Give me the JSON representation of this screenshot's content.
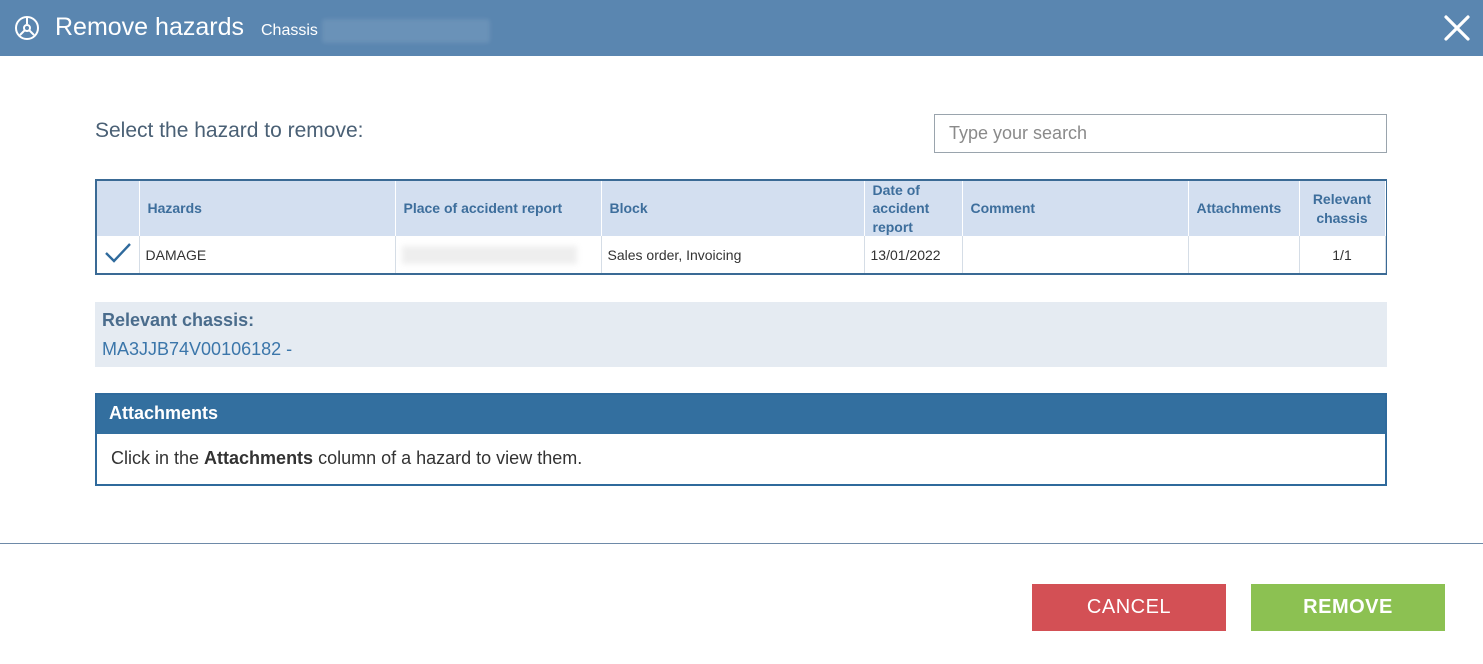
{
  "dialog": {
    "title": "Remove hazards",
    "subtitle": "Chassis"
  },
  "prompt": "Select the hazard to remove:",
  "search": {
    "placeholder": "Type your search",
    "value": ""
  },
  "table": {
    "columns": [
      "Hazards",
      "Place of accident report",
      "Block",
      "Date of accident report",
      "Comment",
      "Attachments",
      "Relevant chassis"
    ],
    "rows": [
      {
        "selected": true,
        "hazard": "DAMAGE",
        "place": "",
        "block": "Sales order, Invoicing",
        "date": "13/01/2022",
        "comment": "",
        "attachments": "",
        "relevant_chassis": "1/1"
      }
    ]
  },
  "relevant": {
    "label": "Relevant chassis:",
    "value": "MA3JJB74V00106182 -"
  },
  "attachments_panel": {
    "header": "Attachments",
    "text_before": "Click in the ",
    "text_bold": "Attachments",
    "text_after": " column of a hazard to view them."
  },
  "buttons": {
    "cancel": "CANCEL",
    "remove": "REMOVE"
  },
  "colors": {
    "titlebar": "#5a86b0",
    "cancel": "#d35055",
    "remove": "#8cc152",
    "panel_header": "#336f9f"
  }
}
